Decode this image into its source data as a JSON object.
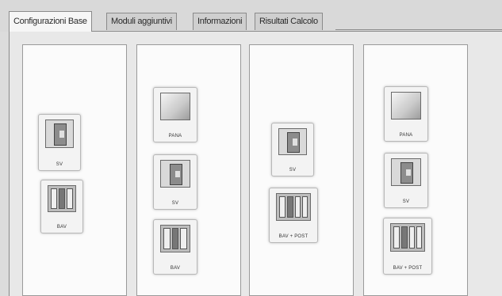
{
  "tabs": [
    "Configurazioni Base",
    "Moduli aggiuntivi",
    "Informazioni",
    "Risultati Calcolo"
  ],
  "modules": {
    "pana": "PANA",
    "sv": "SV",
    "bav": "BAV",
    "bav_post": "BAV + POST"
  }
}
